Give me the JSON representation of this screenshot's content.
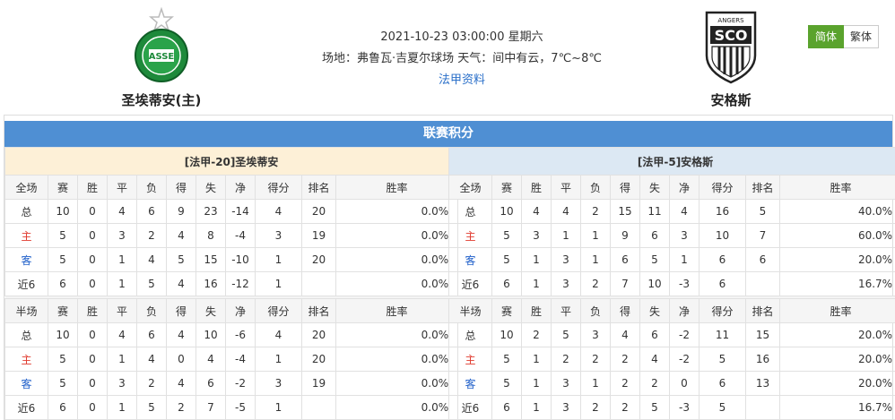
{
  "header": {
    "home_team": "圣埃蒂安(主)",
    "away_team": "安格斯",
    "datetime": "2021-10-23 03:00:00 星期六",
    "venue": "场地：弗鲁瓦·吉夏尔球场 天气：间中有云，7℃~8℃",
    "league_link": "法甲资料",
    "lang_simplified": "简体",
    "lang_traditional": "繁体",
    "home_logo_text": "ASSE",
    "away_logo_text": "SCO",
    "away_logo_top": "ANGERS"
  },
  "standings": {
    "title": "联赛积分",
    "columns": [
      "赛",
      "胜",
      "平",
      "负",
      "得",
      "失",
      "净",
      "得分",
      "排名",
      "胜率"
    ],
    "full_label": "全场",
    "half_label": "半场",
    "home": {
      "team_label": "[法甲-20]圣埃蒂安",
      "full": [
        {
          "label": "总",
          "cells": [
            "10",
            "0",
            "4",
            "6",
            "9",
            "23",
            "-14",
            "4",
            "20",
            "0.0%"
          ]
        },
        {
          "label": "主",
          "cells": [
            "5",
            "0",
            "3",
            "2",
            "4",
            "8",
            "-4",
            "3",
            "19",
            "0.0%"
          ]
        },
        {
          "label": "客",
          "cells": [
            "5",
            "0",
            "1",
            "4",
            "5",
            "15",
            "-10",
            "1",
            "20",
            "0.0%"
          ]
        },
        {
          "label": "近6",
          "cells": [
            "6",
            "0",
            "1",
            "5",
            "4",
            "16",
            "-12",
            "1",
            "",
            "0.0%"
          ]
        }
      ],
      "half": [
        {
          "label": "总",
          "cells": [
            "10",
            "0",
            "4",
            "6",
            "4",
            "10",
            "-6",
            "4",
            "20",
            "0.0%"
          ]
        },
        {
          "label": "主",
          "cells": [
            "5",
            "0",
            "1",
            "4",
            "0",
            "4",
            "-4",
            "1",
            "20",
            "0.0%"
          ]
        },
        {
          "label": "客",
          "cells": [
            "5",
            "0",
            "3",
            "2",
            "4",
            "6",
            "-2",
            "3",
            "19",
            "0.0%"
          ]
        },
        {
          "label": "近6",
          "cells": [
            "6",
            "0",
            "1",
            "5",
            "2",
            "7",
            "-5",
            "1",
            "",
            "0.0%"
          ]
        }
      ]
    },
    "away": {
      "team_label": "[法甲-5]安格斯",
      "full": [
        {
          "label": "总",
          "cells": [
            "10",
            "4",
            "4",
            "2",
            "15",
            "11",
            "4",
            "16",
            "5",
            "40.0%"
          ]
        },
        {
          "label": "主",
          "cells": [
            "5",
            "3",
            "1",
            "1",
            "9",
            "6",
            "3",
            "10",
            "7",
            "60.0%"
          ]
        },
        {
          "label": "客",
          "cells": [
            "5",
            "1",
            "3",
            "1",
            "6",
            "5",
            "1",
            "6",
            "6",
            "20.0%"
          ]
        },
        {
          "label": "近6",
          "cells": [
            "6",
            "1",
            "3",
            "2",
            "7",
            "10",
            "-3",
            "6",
            "",
            "16.7%"
          ]
        }
      ],
      "half": [
        {
          "label": "总",
          "cells": [
            "10",
            "2",
            "5",
            "3",
            "4",
            "6",
            "-2",
            "11",
            "15",
            "20.0%"
          ]
        },
        {
          "label": "主",
          "cells": [
            "5",
            "1",
            "2",
            "2",
            "2",
            "4",
            "-2",
            "5",
            "16",
            "20.0%"
          ]
        },
        {
          "label": "客",
          "cells": [
            "5",
            "1",
            "3",
            "1",
            "2",
            "2",
            "0",
            "6",
            "13",
            "20.0%"
          ]
        },
        {
          "label": "近6",
          "cells": [
            "6",
            "1",
            "3",
            "2",
            "2",
            "5",
            "-3",
            "5",
            "",
            "16.7%"
          ]
        }
      ]
    }
  },
  "colors": {
    "band": "#4f8fd3",
    "home_header": "#fdf0d7",
    "away_header": "#dce8f3",
    "home_label": "#e03a2e",
    "away_label": "#1f5fc9",
    "lang_active": "#5aa32d"
  }
}
